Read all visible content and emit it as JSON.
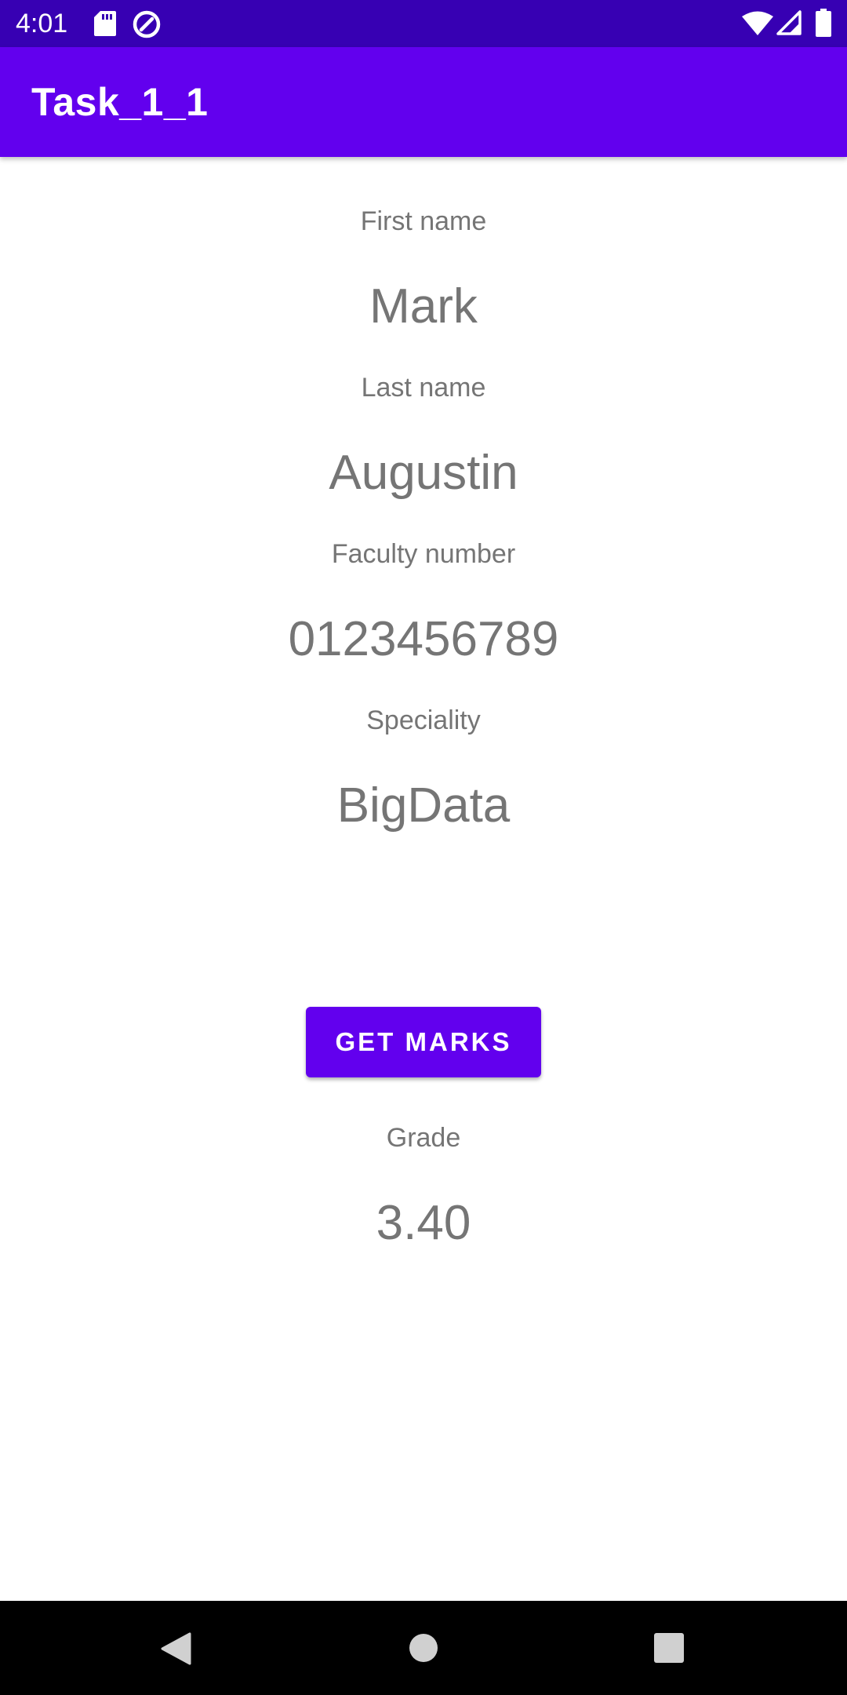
{
  "status_bar": {
    "time": "4:01",
    "icons": [
      "sd-card-icon",
      "data-saver-icon",
      "wifi-icon",
      "cellular-signal-icon",
      "battery-icon"
    ]
  },
  "app_bar": {
    "title": "Task_1_1"
  },
  "fields": {
    "first_name": {
      "label": "First name",
      "value": "Mark"
    },
    "last_name": {
      "label": "Last name",
      "value": "Augustin"
    },
    "faculty_number": {
      "label": "Faculty number",
      "value": "0123456789"
    },
    "speciality": {
      "label": "Speciality",
      "value": "BigData"
    }
  },
  "actions": {
    "get_marks_label": "GET MARKS"
  },
  "grade": {
    "label": "Grade",
    "value": "3.40"
  },
  "nav_bar": {
    "buttons": [
      "back-icon",
      "home-icon",
      "recents-icon"
    ]
  },
  "colors": {
    "status_bar": "#3700B3",
    "primary": "#6200EE",
    "text_secondary": "#757575",
    "background": "#FFFFFF"
  }
}
